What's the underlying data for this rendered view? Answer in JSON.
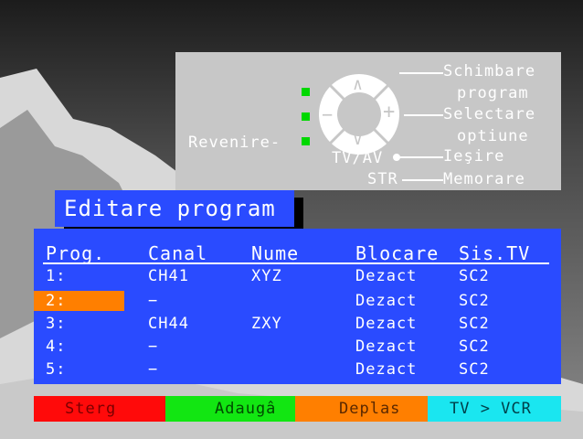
{
  "help": {
    "change_program": [
      "Schimbare",
      "program"
    ],
    "select_option": [
      "Selectare",
      "optiune"
    ],
    "exit": "Ieşire",
    "store": "Memorare",
    "back": "Revenire-",
    "tvav": "TV/AV",
    "str": "STR",
    "up": "∧",
    "down": "∨",
    "minus": "−",
    "plus": "+"
  },
  "title": "Editare program",
  "table": {
    "headers": [
      "Prog.",
      "Canal",
      "Nume",
      "Blocare",
      "Sis.TV"
    ],
    "rows": [
      [
        "1:",
        "CH41",
        "XYZ",
        "Dezact",
        "SC2"
      ],
      [
        "2:",
        "−",
        "",
        "Dezact",
        "SC2"
      ],
      [
        "3:",
        "CH44",
        "ZXY",
        "Dezact",
        "SC2"
      ],
      [
        "4:",
        "−",
        "",
        "Dezact",
        "SC2"
      ],
      [
        "5:",
        "−",
        "",
        "Dezact",
        "SC2"
      ]
    ],
    "selected_row": 1
  },
  "color_bar": {
    "red": "Sterg",
    "green": "Adaugâ",
    "orange": "Deplas",
    "cyan": "TV > VCR"
  },
  "colors": {
    "panel_blue": "#2a4bff",
    "highlight_orange": "#ff7f00",
    "red": "#ff0a0a",
    "green": "#12e612",
    "orange": "#ff7f00",
    "cyan": "#1ae6f0"
  }
}
